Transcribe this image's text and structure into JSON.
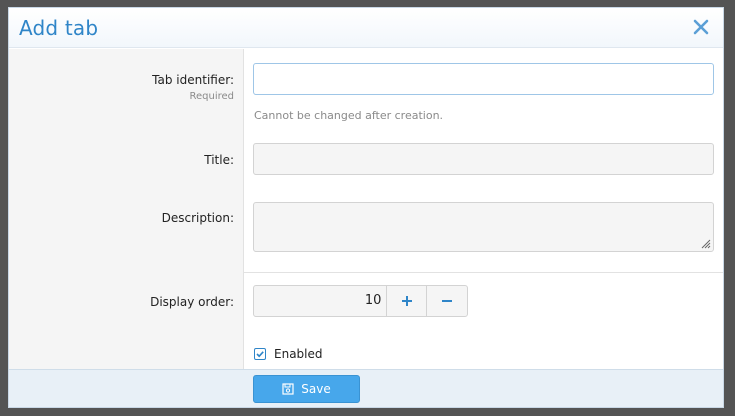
{
  "dialog": {
    "title": "Add tab",
    "close_icon": "close-icon"
  },
  "form": {
    "tab_identifier": {
      "label": "Tab identifier:",
      "required_text": "Required",
      "value": "",
      "hint": "Cannot be changed after creation."
    },
    "title": {
      "label": "Title:",
      "value": ""
    },
    "description": {
      "label": "Description:",
      "value": ""
    },
    "display_order": {
      "label": "Display order:",
      "value": "10",
      "increment_icon": "plus-icon",
      "decrement_icon": "minus-icon"
    },
    "enabled": {
      "label": "Enabled",
      "checked": true
    }
  },
  "footer": {
    "save_label": "Save",
    "save_icon": "save-icon"
  },
  "colors": {
    "accent": "#2f85c8",
    "button": "#47a7eb"
  }
}
